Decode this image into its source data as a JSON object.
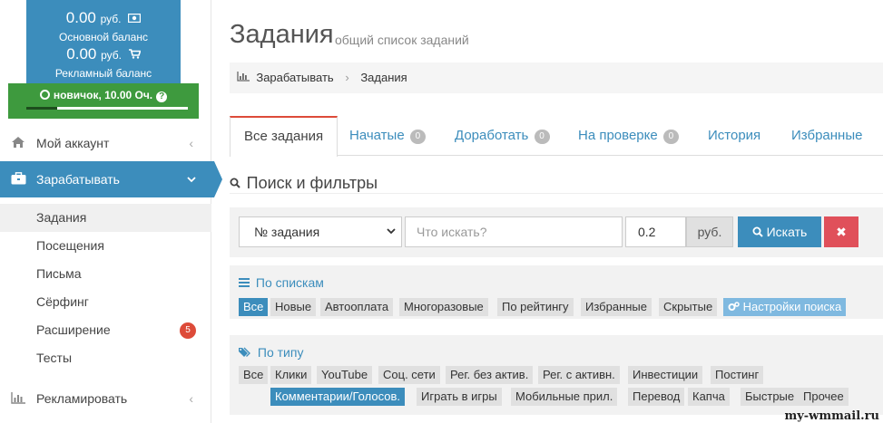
{
  "balance": {
    "main_amount": "0.00",
    "main_currency": "руб.",
    "main_label": "Основной баланс",
    "ad_amount": "0.00",
    "ad_currency": "руб.",
    "ad_label": "Рекламный баланс",
    "main_icon": "money-icon",
    "ad_icon": "cart-icon"
  },
  "status": {
    "text": "новичок, 10.00 Оч.",
    "help": "?",
    "progress_fraction": 0.19
  },
  "menu": {
    "account": {
      "label": "Мой аккаунт",
      "icon": "home-icon",
      "chevron": "‹"
    },
    "earn": {
      "label": "Зарабатывать",
      "icon": "briefcase-icon",
      "chevron": "⌄"
    },
    "advertise": {
      "label": "Рекламировать",
      "icon": "bar-chart-icon",
      "chevron": "‹"
    },
    "submenu": [
      {
        "label": "Задания"
      },
      {
        "label": "Посещения"
      },
      {
        "label": "Письма"
      },
      {
        "label": "Сёрфинг"
      },
      {
        "label": "Расширение",
        "badge": "5"
      },
      {
        "label": "Тесты"
      }
    ]
  },
  "page": {
    "title": "Задания",
    "subtitle": "общий список заданий"
  },
  "breadcrumb": {
    "parent": "Зарабатывать",
    "current": "Задания",
    "separator": "›"
  },
  "tabs": [
    {
      "label": "Все задания"
    },
    {
      "label": "Начатые",
      "badge": "0"
    },
    {
      "label": "Доработать",
      "badge": "0"
    },
    {
      "label": "На проверке",
      "badge": "0"
    },
    {
      "label": "История"
    },
    {
      "label": "Избранные"
    }
  ],
  "filters": {
    "title": "Поиск и фильтры",
    "select_value": "№ задания",
    "search_placeholder": "Что искать?",
    "price_value": "0.2",
    "price_unit": "руб.",
    "search_button": "Искать",
    "clear_button": "✖"
  },
  "lists": {
    "title": "По спискам",
    "chips": [
      "Все",
      "Новые",
      "Автооплата",
      "Многоразовые",
      "По рейтингу",
      "Избранные",
      "Скрытые"
    ],
    "settings_chip": "Настройки поиска"
  },
  "types": {
    "title": "По типу",
    "row1": [
      "Все",
      "Клики",
      "YouTube",
      "Соц. сети",
      "Рег. без актив.",
      "Рег. с активн.",
      "Инвестиции",
      "Постинг"
    ],
    "row2": [
      "Комментарии/Голосов.",
      "Играть в игры",
      "Мобильные прил.",
      "Перевод",
      "Капча",
      "Быстрые",
      "Прочее"
    ]
  },
  "watermark": "my-wmmail.ru",
  "colors": {
    "primary": "#3c8dbc",
    "success": "#3e9a3e",
    "danger": "#dd4b39"
  }
}
